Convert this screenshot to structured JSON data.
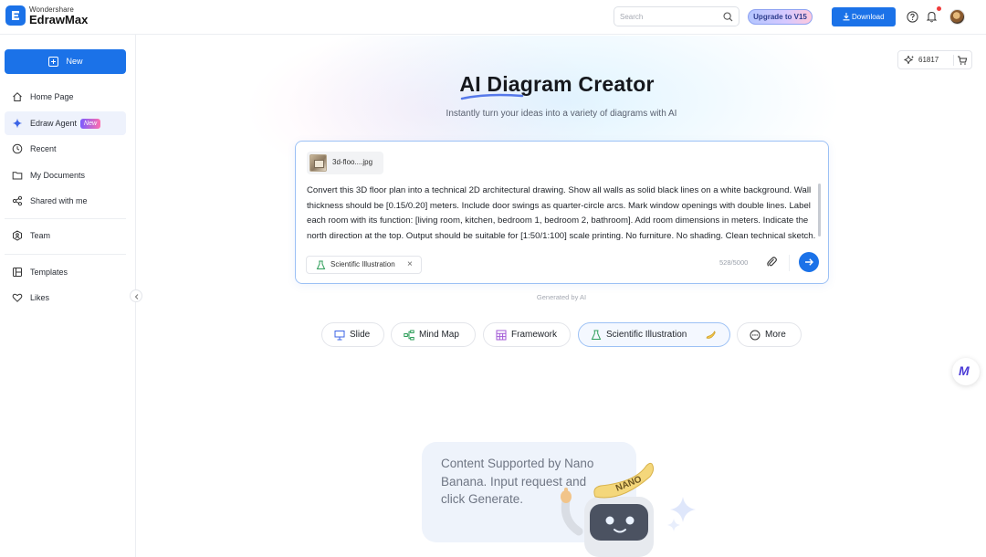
{
  "app": {
    "brand_top": "Wondershare",
    "brand_name": "EdrawMax"
  },
  "topbar": {
    "search_placeholder": "Search",
    "upgrade_label": "Upgrade to V15",
    "download_label": "Download"
  },
  "sidebar": {
    "new_label": "New",
    "items": [
      {
        "label": "Home Page",
        "icon": "home-icon"
      },
      {
        "label": "Edraw Agent",
        "icon": "sparkle-icon",
        "badge": "New"
      },
      {
        "label": "Recent",
        "icon": "clock-icon"
      },
      {
        "label": "My Documents",
        "icon": "folder-icon"
      },
      {
        "label": "Shared with me",
        "icon": "share-icon"
      },
      {
        "label": "Team",
        "icon": "team-icon"
      },
      {
        "label": "Templates",
        "icon": "templates-icon"
      },
      {
        "label": "Likes",
        "icon": "heart-icon"
      }
    ]
  },
  "header": {
    "credits": "61817",
    "title": "AI Diagram Creator",
    "subtitle": "Instantly turn your ideas into a variety of diagrams with AI"
  },
  "prompt": {
    "attachment_name": "3d-floo....jpg",
    "text": "Convert this 3D floor plan into a technical 2D architectural drawing. Show all walls as solid black lines on a white background. Wall thickness should be [0.15/0.20] meters. Include door swings as quarter-circle arcs. Mark window openings with double lines. Label each room with its function: [living room, kitchen, bedroom 1, bedroom 2, bathroom]. Add room dimensions in meters. Indicate the north direction at the top. Output should be suitable for [1:50/1:100] scale printing. No furniture. No shading. Clean technical sketch.",
    "chip_label": "Scientific Illustration",
    "chip_close": "×",
    "counter": "528/5000"
  },
  "generated_label": "Generated by AI",
  "types": [
    {
      "label": "Slide",
      "icon": "slide-icon"
    },
    {
      "label": "Mind Map",
      "icon": "mindmap-icon"
    },
    {
      "label": "Framework",
      "icon": "framework-icon"
    },
    {
      "label": "Scientific Illustration",
      "icon": "flask-icon",
      "selected": true
    },
    {
      "label": "More",
      "icon": "more-icon"
    }
  ],
  "promo": {
    "text": "Content Supported by Nano Banana. Input  request and click Generate.",
    "mascot_label": "NANO"
  },
  "colors": {
    "accent": "#1b72e8",
    "selected_border": "#9cc1f5",
    "sidebar_active": "#eef2fc"
  }
}
